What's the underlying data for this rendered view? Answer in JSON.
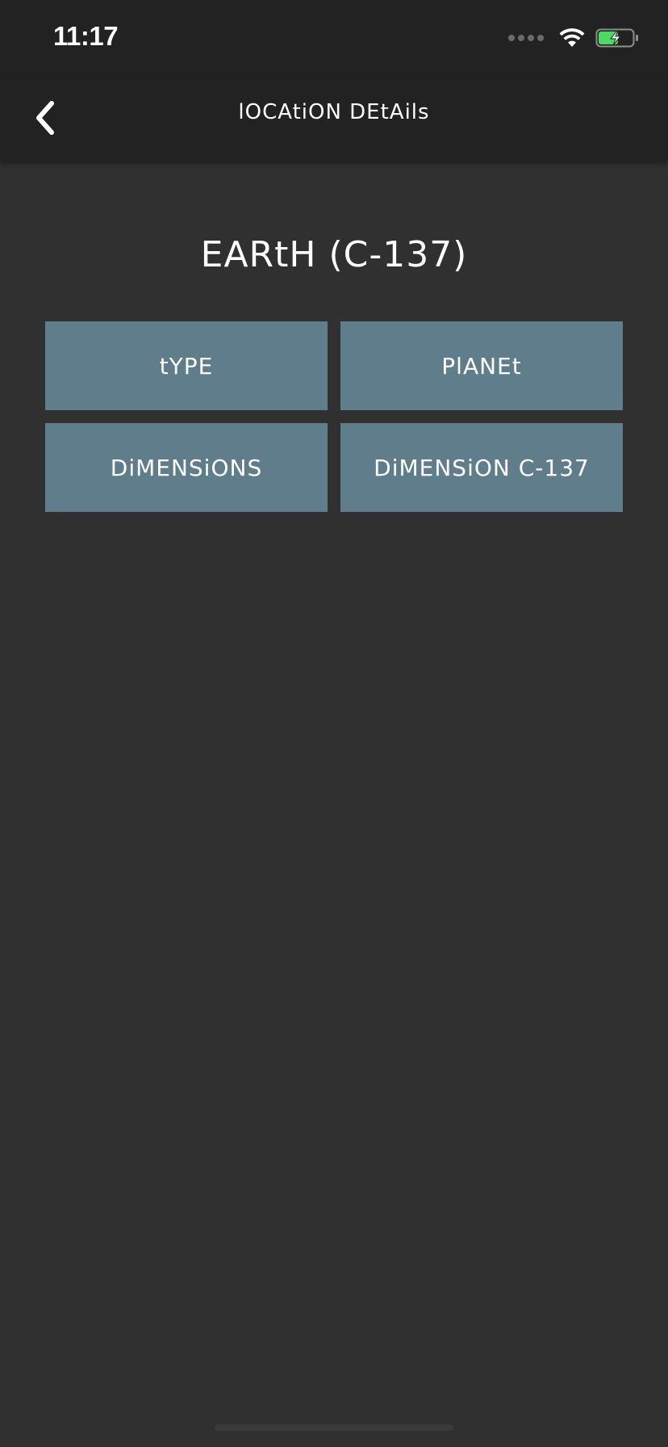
{
  "status_bar": {
    "time": "11:17"
  },
  "nav": {
    "title": "lOCAtiON DEtAils"
  },
  "location": {
    "name": "EARtH (C-137)"
  },
  "details": [
    {
      "label": "tYPE",
      "value": "PlANEt"
    },
    {
      "label": "DiMENSiONS",
      "value": "DiMENSiON C-137"
    }
  ],
  "colors": {
    "background": "#303030",
    "bar": "#222222",
    "cell": "#607d8b",
    "battery": "#4cd964"
  },
  "icons": {
    "back": "chevron-left-icon",
    "wifi": "wifi-icon",
    "battery": "battery-charging-icon",
    "signal": "signal-dots-icon"
  }
}
